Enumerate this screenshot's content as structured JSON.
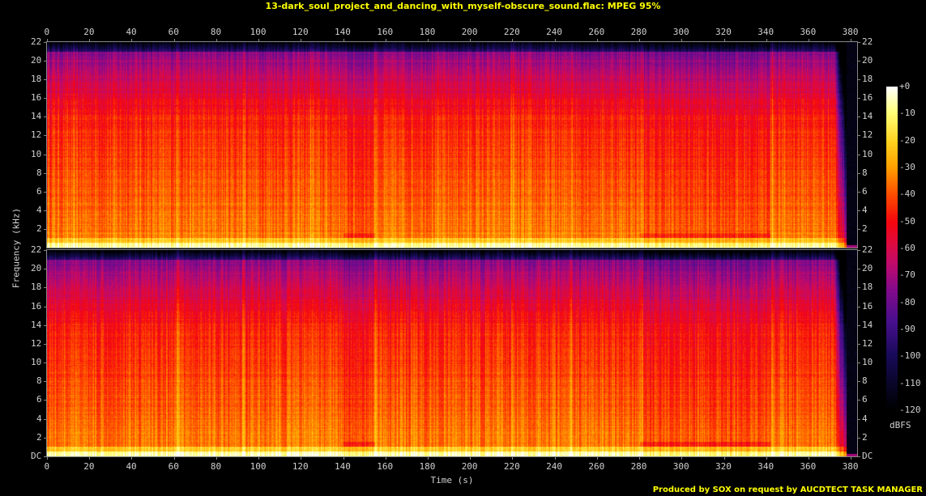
{
  "title": "13-dark_soul_project_and_dancing_with_myself-obscure_sound.flac: MPEG 95%",
  "footer": "Produced by SOX on request by AUCDTECT TASK MANAGER",
  "chart_data": {
    "type": "heatmap",
    "subtype": "spectrogram",
    "channels": 2,
    "xlabel": "Time (s)",
    "ylabel": "Frequency (kHz)",
    "xlim": [
      0,
      383
    ],
    "ylim": [
      0,
      22
    ],
    "x_ticks": [
      "0",
      "20",
      "40",
      "60",
      "80",
      "100",
      "120",
      "140",
      "160",
      "180",
      "200",
      "220",
      "240",
      "260",
      "280",
      "300",
      "320",
      "340",
      "360",
      "380"
    ],
    "y_ticks_top": [
      "2",
      "4",
      "6",
      "8",
      "10",
      "12",
      "14",
      "16",
      "18",
      "20",
      "22"
    ],
    "y_ticks_bottom": [
      "DC",
      "2",
      "4",
      "6",
      "8",
      "10",
      "12",
      "14",
      "16",
      "18",
      "20",
      "22"
    ],
    "colorbar": {
      "label": "dBFS",
      "range": [
        -120,
        0
      ],
      "ticks": [
        "+0",
        "-10",
        "-20",
        "-30",
        "-40",
        "-50",
        "-60",
        "-70",
        "-80",
        "-90",
        "-100",
        "-110",
        "-120"
      ]
    },
    "lowpass_cutoff_khz": 21,
    "section_breaks_s": [
      62,
      93,
      125,
      155,
      220,
      248,
      281,
      343
    ],
    "fade_out_s": [
      372,
      378
    ],
    "end_s": 383
  }
}
